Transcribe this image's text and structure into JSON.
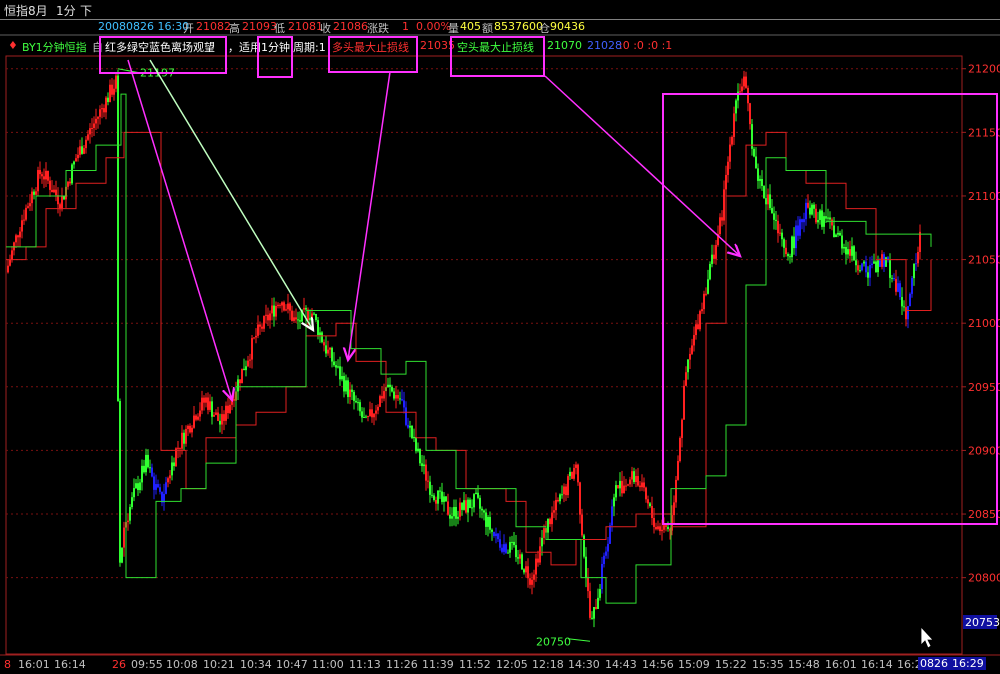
{
  "title": {
    "instrument": "恒指8月",
    "period": "1分",
    "direction": "下"
  },
  "status": {
    "date_time": "20080826 16:30",
    "open_label": "开",
    "open": "21082",
    "high_label": "高",
    "high": "21093",
    "low_label": "低",
    "low": "21081",
    "close_label": "收",
    "close": "21086",
    "change_label": "涨跌",
    "change": "1",
    "change_pct": "0.00%",
    "volume_label": "量",
    "volume": "405",
    "amount_label": "额",
    "amount": "8537600",
    "oi_label": "仓",
    "oi": "90436"
  },
  "indicator": {
    "name": "BY1分钟恒指",
    "prefix": "自",
    "caption1": "红多绿空蓝色离场观望",
    "caption2": "，适用",
    "caption3": "1分钟",
    "caption4": "周期:1",
    "long_stop_label": "多头最大止损线",
    "long_stop": "21035",
    "short_stop_label": "空头最大止损线",
    "short_stop": "21070",
    "blue_value": "21028",
    "flags": ":0 :0 :0 :1"
  },
  "price_axis": [
    "21200",
    "21150",
    "21100",
    "21050",
    "21000",
    "20950",
    "20900",
    "20850",
    "20800"
  ],
  "current_price_tag": "20753",
  "peak_label": "21197",
  "trough_label": "20750",
  "time_axis": [
    "16:01",
    "16:14",
    "26",
    "09:55",
    "10:08",
    "10:21",
    "10:34",
    "10:47",
    "11:00",
    "11:13",
    "11:26",
    "11:39",
    "11:52",
    "12:05",
    "12:18",
    "14:30",
    "14:43",
    "14:56",
    "15:09",
    "15:22",
    "15:35",
    "15:48",
    "16:01",
    "16:14",
    "16:2"
  ],
  "time_axis_left_fragment": "8",
  "date_tag": "0826",
  "time_tag": "16:29",
  "colors": {
    "up": "#ff2020",
    "down": "#30ff30",
    "exit": "#2020ff",
    "stop_long": "#e02020",
    "stop_short": "#30e030",
    "annot": "#ff30ff",
    "grid": "#7a1010",
    "axis": "#a02020"
  },
  "chart_data": {
    "type": "candlestick",
    "ylim": [
      20740,
      21210
    ],
    "long_stop_line": [
      [
        0,
        21050
      ],
      [
        20,
        21060
      ],
      [
        40,
        21090
      ],
      [
        70,
        21110
      ],
      [
        100,
        21130
      ],
      [
        118,
        21150
      ],
      [
        150,
        21150
      ],
      [
        155,
        20900
      ],
      [
        180,
        20870
      ],
      [
        200,
        20910
      ],
      [
        230,
        20920
      ],
      [
        250,
        20930
      ],
      [
        280,
        20950
      ],
      [
        300,
        20990
      ],
      [
        330,
        21000
      ],
      [
        350,
        20970
      ],
      [
        380,
        20930
      ],
      [
        410,
        20910
      ],
      [
        430,
        20900
      ],
      [
        460,
        20870
      ],
      [
        500,
        20860
      ],
      [
        520,
        20820
      ],
      [
        545,
        20810
      ],
      [
        570,
        20830
      ],
      [
        600,
        20840
      ],
      [
        630,
        20850
      ],
      [
        665,
        20840
      ],
      [
        700,
        21000
      ],
      [
        720,
        21100
      ],
      [
        740,
        21140
      ],
      [
        760,
        21150
      ],
      [
        780,
        21120
      ],
      [
        800,
        21110
      ],
      [
        840,
        21090
      ],
      [
        870,
        21050
      ],
      [
        900,
        21010
      ],
      [
        925,
        21050
      ]
    ],
    "short_stop_line": [
      [
        0,
        21060
      ],
      [
        30,
        21100
      ],
      [
        60,
        21120
      ],
      [
        90,
        21140
      ],
      [
        115,
        21180
      ],
      [
        120,
        20800
      ],
      [
        150,
        20860
      ],
      [
        175,
        20870
      ],
      [
        200,
        20890
      ],
      [
        230,
        20950
      ],
      [
        260,
        20950
      ],
      [
        300,
        21010
      ],
      [
        320,
        21010
      ],
      [
        345,
        20980
      ],
      [
        375,
        20960
      ],
      [
        400,
        20970
      ],
      [
        420,
        20900
      ],
      [
        450,
        20870
      ],
      [
        480,
        20870
      ],
      [
        510,
        20840
      ],
      [
        540,
        20830
      ],
      [
        575,
        20800
      ],
      [
        600,
        20780
      ],
      [
        630,
        20810
      ],
      [
        665,
        20870
      ],
      [
        700,
        20880
      ],
      [
        720,
        20920
      ],
      [
        740,
        21030
      ],
      [
        760,
        21130
      ],
      [
        780,
        21120
      ],
      [
        820,
        21080
      ],
      [
        860,
        21070
      ],
      [
        900,
        21070
      ],
      [
        925,
        21060
      ]
    ],
    "candles_hint": "dense 1-minute bars; red=up, green=down, blue=exit"
  }
}
